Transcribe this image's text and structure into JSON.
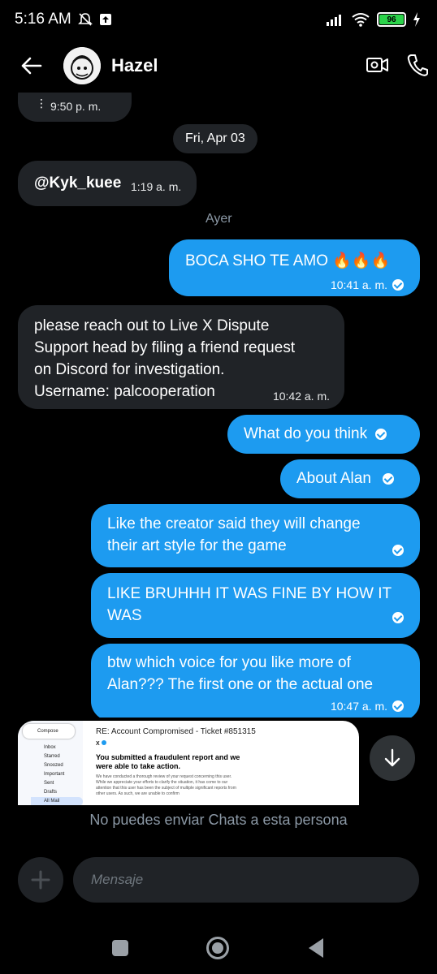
{
  "status_bar": {
    "time": "5:16 AM",
    "battery": "96"
  },
  "header": {
    "title": "Hazel"
  },
  "messages": {
    "m0": {
      "time": "9:50 p. m."
    },
    "date_pill": "Fri, Apr 03",
    "m1": {
      "text": "@Kyk_kuee",
      "time": "1:19 a. m."
    },
    "day_label": "Ayer",
    "m2": {
      "text": "BOCA SHO TE AMO 🔥🔥🔥",
      "time": "10:41 a. m."
    },
    "m3": {
      "line1": "please reach out to Live X Dispute",
      "line2": "Support head by filing a friend request",
      "line3": "on Discord for investigation.",
      "line4": "Username: palcooperation",
      "time": "10:42 a. m."
    },
    "m4": {
      "text": "What do you think"
    },
    "m5": {
      "text": "About Alan"
    },
    "m6": {
      "line1": "Like the creator said they will change",
      "line2": "their art style for the game"
    },
    "m7": {
      "line1": "LIKE BRUHHH IT WAS FINE BY HOW IT",
      "line2": "WAS"
    },
    "m8": {
      "line1": "btw which voice for you like more of",
      "line2": "Alan??? The first one or the actual one",
      "time": "10:47 a. m."
    }
  },
  "image_preview": {
    "subject": "RE: Account Compromised - Ticket #851315",
    "sender": "X",
    "compose": "Compose",
    "folders": [
      "Inbox",
      "Starred",
      "Snoozed",
      "Important",
      "Sent",
      "Drafts",
      "All Mail"
    ],
    "body_title": "You submitted a fraudulent report and we were able to take action.",
    "body_text": "We have conducted a thorough review of your request concerning this user. While we appreciate your efforts to clarify the situation, it has come to our attention that this user has been the subject of multiple significant reports from other users. As such, we are unable to confirm"
  },
  "notice": "No puedes enviar Chats a esta persona",
  "composer": {
    "placeholder": "Mensaje"
  }
}
